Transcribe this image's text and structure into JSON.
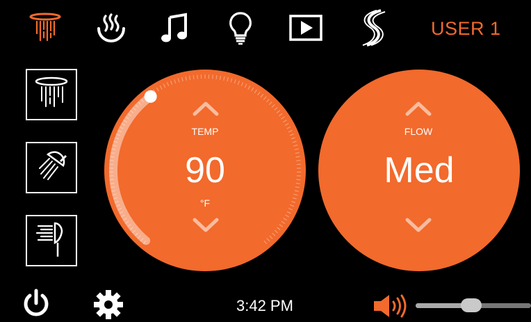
{
  "header": {
    "user_label": "USER 1"
  },
  "top_nav": [
    {
      "icon": "rain-shower-icon",
      "active": true
    },
    {
      "icon": "steam-icon",
      "active": false
    },
    {
      "icon": "music-icon",
      "active": false
    },
    {
      "icon": "light-bulb-icon",
      "active": false
    },
    {
      "icon": "video-play-icon",
      "active": false
    },
    {
      "icon": "brand-logo-icon",
      "active": false
    }
  ],
  "side_outlets": [
    {
      "icon": "rain-head-outlet-icon"
    },
    {
      "icon": "handheld-shower-outlet-icon"
    },
    {
      "icon": "body-spray-outlet-icon"
    }
  ],
  "temp_dial": {
    "label": "TEMP",
    "value": "90",
    "unit": "°F",
    "level_fraction": 0.37
  },
  "flow_dial": {
    "label": "FLOW",
    "value": "Med"
  },
  "footer": {
    "time": "3:42 PM",
    "volume_fraction": 0.48
  },
  "colors": {
    "accent": "#F26A2C",
    "background": "#000000",
    "text": "#FFFFFF"
  }
}
